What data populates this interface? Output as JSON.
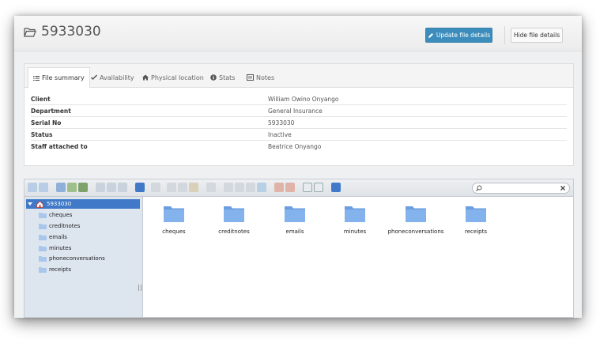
{
  "header": {
    "title": "5933030",
    "update_label": "Update file details",
    "hide_label": "Hide file details"
  },
  "tabs": [
    {
      "label": "File summary",
      "icon": "list-icon"
    },
    {
      "label": "Availability",
      "icon": "check-icon"
    },
    {
      "label": "Physical location",
      "icon": "home-icon"
    },
    {
      "label": "Stats",
      "icon": "info-icon"
    },
    {
      "label": "Notes",
      "icon": "notes-icon"
    }
  ],
  "summary": [
    {
      "key": "Client",
      "value": "William Owino Onyango"
    },
    {
      "key": "Department",
      "value": "General Insurance"
    },
    {
      "key": "Serial No",
      "value": "5933030"
    },
    {
      "key": "Status",
      "value": "Inactive"
    },
    {
      "key": "Staff attached to",
      "value": "Beatrice Onyango"
    }
  ],
  "filemanager": {
    "search_placeholder": "",
    "tree_root": "5933030",
    "folders": [
      "cheques",
      "creditnotes",
      "emails",
      "minutes",
      "phoneconversations",
      "receipts"
    ]
  },
  "colors": {
    "primary": "#3c8dbc",
    "tree_selected": "#3f79c7",
    "folder": "#6a9ee0"
  }
}
